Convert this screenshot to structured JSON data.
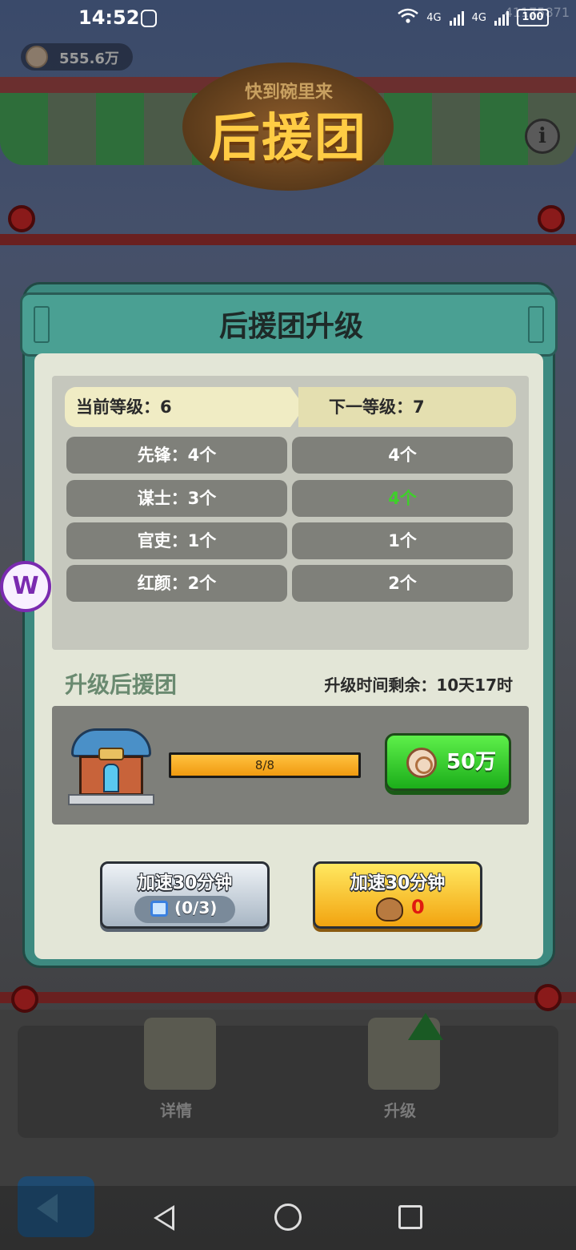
{
  "status": {
    "time": "14:52",
    "network_a": "4G",
    "network_b": "4G",
    "battery": "100",
    "ghost_id": "41175871"
  },
  "hud": {
    "coins": "555.6万",
    "info_label": "i"
  },
  "banner": {
    "top_text": "快到碗里来",
    "title": "后援团"
  },
  "modal": {
    "title": "后援团升级",
    "current_level": "当前等级：6",
    "next_level": "下一等级：7",
    "rows": [
      {
        "current": "先锋：4个",
        "next": "4个",
        "next_highlight": false
      },
      {
        "current": "谋士：3个",
        "next": "4个",
        "next_highlight": true
      },
      {
        "current": "官吏：1个",
        "next": "1个",
        "next_highlight": false
      },
      {
        "current": "红颜：2个",
        "next": "2个",
        "next_highlight": false
      }
    ],
    "upgrade_title": "升级后援团",
    "time_remaining": "升级时间剩余：10天17时",
    "progress_text": "8/8",
    "progress_value": 1.0,
    "cost": "50万",
    "speed_ad": {
      "label": "加速30分钟",
      "count": "(0/3)"
    },
    "speed_item": {
      "label": "加速30分钟",
      "count": "0"
    }
  },
  "bottom_nav": {
    "details": "详情",
    "upgrade": "升级"
  },
  "colors": {
    "modal_frame": "#3d8a80",
    "highlight_green": "#3ed02a",
    "cost_button": "#2ccf28",
    "speed_item_button": "#f7c628"
  }
}
